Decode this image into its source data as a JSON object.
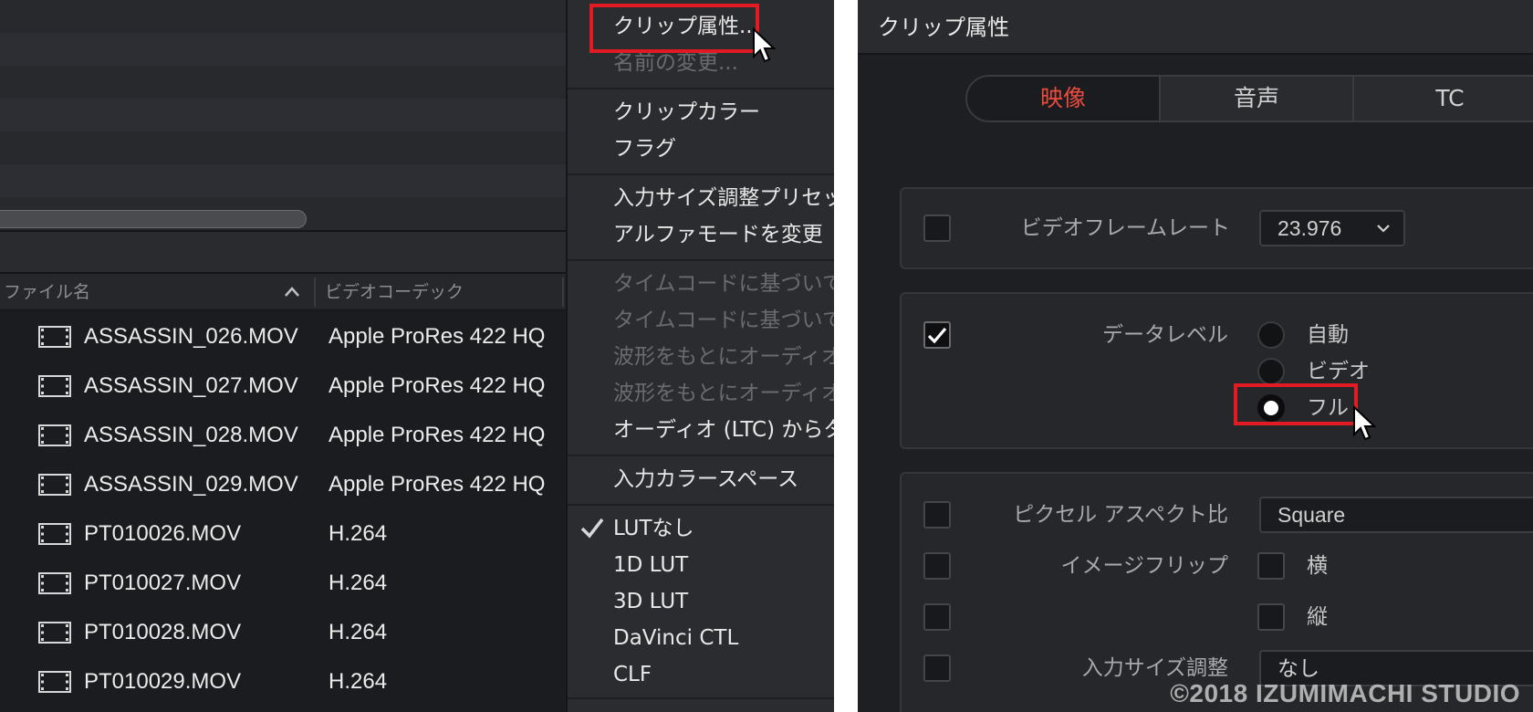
{
  "media_pool": {
    "columns": {
      "file_name": "ファイル名",
      "video_codec": "ビデオコーデック"
    },
    "files": [
      {
        "name": "ASSASSIN_026.MOV",
        "codec": "Apple ProRes 422 HQ"
      },
      {
        "name": "ASSASSIN_027.MOV",
        "codec": "Apple ProRes 422 HQ"
      },
      {
        "name": "ASSASSIN_028.MOV",
        "codec": "Apple ProRes 422 HQ"
      },
      {
        "name": "ASSASSIN_029.MOV",
        "codec": "Apple ProRes 422 HQ"
      },
      {
        "name": "PT010026.MOV",
        "codec": "H.264"
      },
      {
        "name": "PT010027.MOV",
        "codec": "H.264"
      },
      {
        "name": "PT010028.MOV",
        "codec": "H.264"
      },
      {
        "name": "PT010029.MOV",
        "codec": "H.264"
      }
    ]
  },
  "context_menu": {
    "clip_attributes": "クリップ属性...",
    "rename": "名前の変更...",
    "clip_color": "クリップカラー",
    "flag": "フラグ",
    "input_sizing_preset": "入力サイズ調整プリセット",
    "change_alpha_mode": "アルファモードを変更",
    "timecode_based_1": "タイムコードに基づいてオ",
    "timecode_based_2": "タイムコードに基づいてオ",
    "waveform_based_1": "波形をもとにオーディオを",
    "waveform_based_2": "波形をもとにオーディオを",
    "audio_ltc": "オーディオ (LTC) からタイ",
    "input_color_space": "入力カラースペース",
    "lut_none": "LUTなし",
    "lut_1d": "1D LUT",
    "lut_3d": "3D LUT",
    "davinci_ctl": "DaVinci CTL",
    "clf": "CLF"
  },
  "dialog": {
    "title": "クリップ属性",
    "tabs": {
      "video": "映像",
      "audio": "音声",
      "tc": "TC"
    },
    "video_frame_rate": {
      "label": "ビデオフレームレート",
      "value": "23.976"
    },
    "data_level": {
      "label": "データレベル",
      "options": {
        "auto": "自動",
        "video": "ビデオ",
        "full": "フル"
      },
      "selected": "フル"
    },
    "pixel_aspect": {
      "label": "ピクセル アスペクト比",
      "value": "Square"
    },
    "image_flip": {
      "label": "イメージフリップ",
      "horizontal": "横",
      "vertical": "縦"
    },
    "input_sizing": {
      "label": "入力サイズ調整",
      "value": "なし"
    }
  },
  "watermark": "©2018 IZUMIMACHI STUDIO",
  "colors": {
    "accent": "#ea4b3e",
    "highlight": "#e11b23",
    "panel": "#1b1c1f"
  }
}
